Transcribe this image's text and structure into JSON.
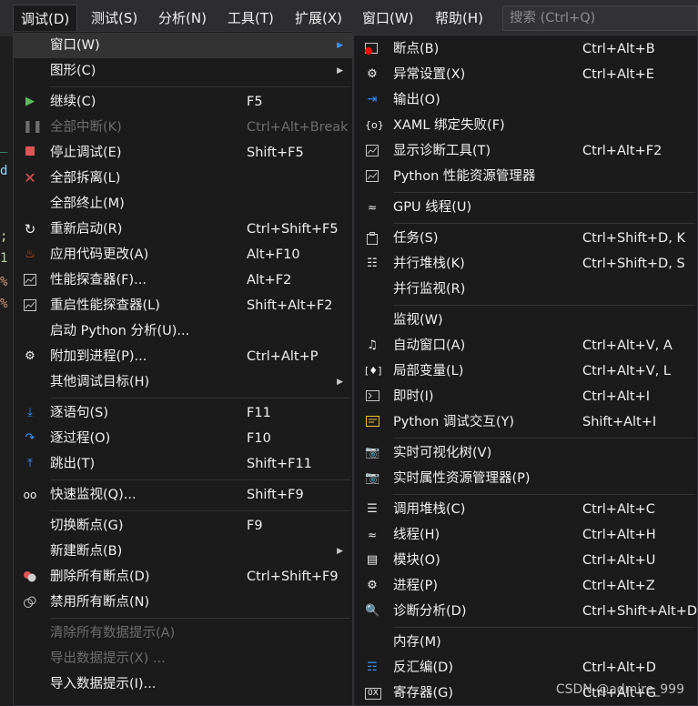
{
  "menubar": {
    "items": [
      {
        "label": "调试(D)",
        "active": true
      },
      {
        "label": "测试(S)"
      },
      {
        "label": "分析(N)"
      },
      {
        "label": "工具(T)"
      },
      {
        "label": "扩展(X)"
      },
      {
        "label": "窗口(W)"
      },
      {
        "label": "帮助(H)"
      }
    ],
    "search_placeholder": "搜索 (Ctrl+Q)"
  },
  "debug_menu": {
    "items": [
      {
        "label": "窗口(W)",
        "submenu": true,
        "highlight": true
      },
      {
        "label": "图形(C)",
        "submenu": true
      },
      {
        "label": "继续(C)",
        "shortcut": "F5",
        "icon": "continue-play-icon"
      },
      {
        "label": "全部中断(K)",
        "shortcut": "Ctrl+Alt+Break",
        "disabled": true,
        "icon": "pause-icon"
      },
      {
        "label": "停止调试(E)",
        "shortcut": "Shift+F5",
        "icon": "stop-icon"
      },
      {
        "label": "全部拆离(L)",
        "icon": "detach-x-icon"
      },
      {
        "label": "全部终止(M)"
      },
      {
        "label": "重新启动(R)",
        "shortcut": "Ctrl+Shift+F5",
        "icon": "restart-icon"
      },
      {
        "label": "应用代码更改(A)",
        "shortcut": "Alt+F10",
        "icon": "hot-reload-flame-icon"
      },
      {
        "label": "性能探查器(F)...",
        "shortcut": "Alt+F2",
        "icon": "profiler-icon"
      },
      {
        "label": "重启性能探查器(L)",
        "shortcut": "Shift+Alt+F2",
        "icon": "profiler-restart-icon"
      },
      {
        "label": "启动 Python 分析(U)..."
      },
      {
        "label": "附加到进程(P)...",
        "shortcut": "Ctrl+Alt+P",
        "icon": "attach-gears-icon"
      },
      {
        "label": "其他调试目标(H)",
        "submenu": true
      },
      {
        "label": "逐语句(S)",
        "shortcut": "F11",
        "icon": "step-into-icon"
      },
      {
        "label": "逐过程(O)",
        "shortcut": "F10",
        "icon": "step-over-icon"
      },
      {
        "label": "跳出(T)",
        "shortcut": "Shift+F11",
        "icon": "step-out-icon"
      },
      {
        "label": "快速监视(Q)...",
        "shortcut": "Shift+F9",
        "icon": "glasses-icon"
      },
      {
        "label": "切换断点(G)",
        "shortcut": "F9"
      },
      {
        "label": "新建断点(B)",
        "submenu": true
      },
      {
        "label": "删除所有断点(D)",
        "shortcut": "Ctrl+Shift+F9",
        "icon": "delete-breakpoints-icon"
      },
      {
        "label": "禁用所有断点(N)",
        "icon": "disable-breakpoints-icon"
      },
      {
        "label": "清除所有数据提示(A)",
        "disabled": true
      },
      {
        "label": "导出数据提示(X) ...",
        "disabled": true
      },
      {
        "label": "导入数据提示(I)..."
      }
    ]
  },
  "window_submenu": {
    "items": [
      {
        "label": "断点(B)",
        "shortcut": "Ctrl+Alt+B",
        "icon": "breakpoints-window-icon"
      },
      {
        "label": "异常设置(X)",
        "shortcut": "Ctrl+Alt+E",
        "icon": "exception-settings-icon"
      },
      {
        "label": "输出(O)",
        "icon": "output-icon"
      },
      {
        "label": "XAML 绑定失败(F)",
        "icon": "xaml-binding-icon"
      },
      {
        "label": "显示诊断工具(T)",
        "shortcut": "Ctrl+Alt+F2",
        "icon": "diagnostic-tools-icon"
      },
      {
        "label": "Python 性能资源管理器",
        "icon": "python-performance-icon"
      },
      {
        "label": "GPU 线程(U)",
        "icon": "gpu-threads-icon"
      },
      {
        "label": "任务(S)",
        "shortcut": "Ctrl+Shift+D, K",
        "icon": "tasks-icon"
      },
      {
        "label": "并行堆栈(K)",
        "shortcut": "Ctrl+Shift+D, S",
        "icon": "parallel-stacks-icon"
      },
      {
        "label": "并行监视(R)"
      },
      {
        "label": "监视(W)"
      },
      {
        "label": "自动窗口(A)",
        "shortcut": "Ctrl+Alt+V, A",
        "icon": "autos-icon"
      },
      {
        "label": "局部变量(L)",
        "shortcut": "Ctrl+Alt+V, L",
        "icon": "locals-icon"
      },
      {
        "label": "即时(I)",
        "shortcut": "Ctrl+Alt+I",
        "icon": "immediate-icon"
      },
      {
        "label": "Python 调试交互(Y)",
        "shortcut": "Shift+Alt+I",
        "icon": "python-interactive-icon"
      },
      {
        "label": "实时可视化树(V)",
        "icon": "live-visual-tree-icon"
      },
      {
        "label": "实时属性资源管理器(P)",
        "icon": "live-property-explorer-icon"
      },
      {
        "label": "调用堆栈(C)",
        "shortcut": "Ctrl+Alt+C",
        "icon": "call-stack-icon"
      },
      {
        "label": "线程(H)",
        "shortcut": "Ctrl+Alt+H",
        "icon": "threads-icon"
      },
      {
        "label": "模块(O)",
        "shortcut": "Ctrl+Alt+U",
        "icon": "modules-icon"
      },
      {
        "label": "进程(P)",
        "shortcut": "Ctrl+Alt+Z",
        "icon": "processes-icon"
      },
      {
        "label": "诊断分析(D)",
        "shortcut": "Ctrl+Shift+Alt+D",
        "icon": "diagnostic-analysis-icon"
      },
      {
        "label": "内存(M)"
      },
      {
        "label": "反汇编(D)",
        "shortcut": "Ctrl+Alt+D",
        "icon": "disassembly-icon"
      },
      {
        "label": "寄存器(G)",
        "shortcut": "Ctrl+Alt+G",
        "icon": "registers-icon"
      }
    ]
  },
  "watermark": "CSDN @admire_999",
  "colors": {
    "accent_blue": "#3794ff",
    "red": "#e51400",
    "green": "#388a34",
    "menu_bg": "#1b1b1c"
  }
}
